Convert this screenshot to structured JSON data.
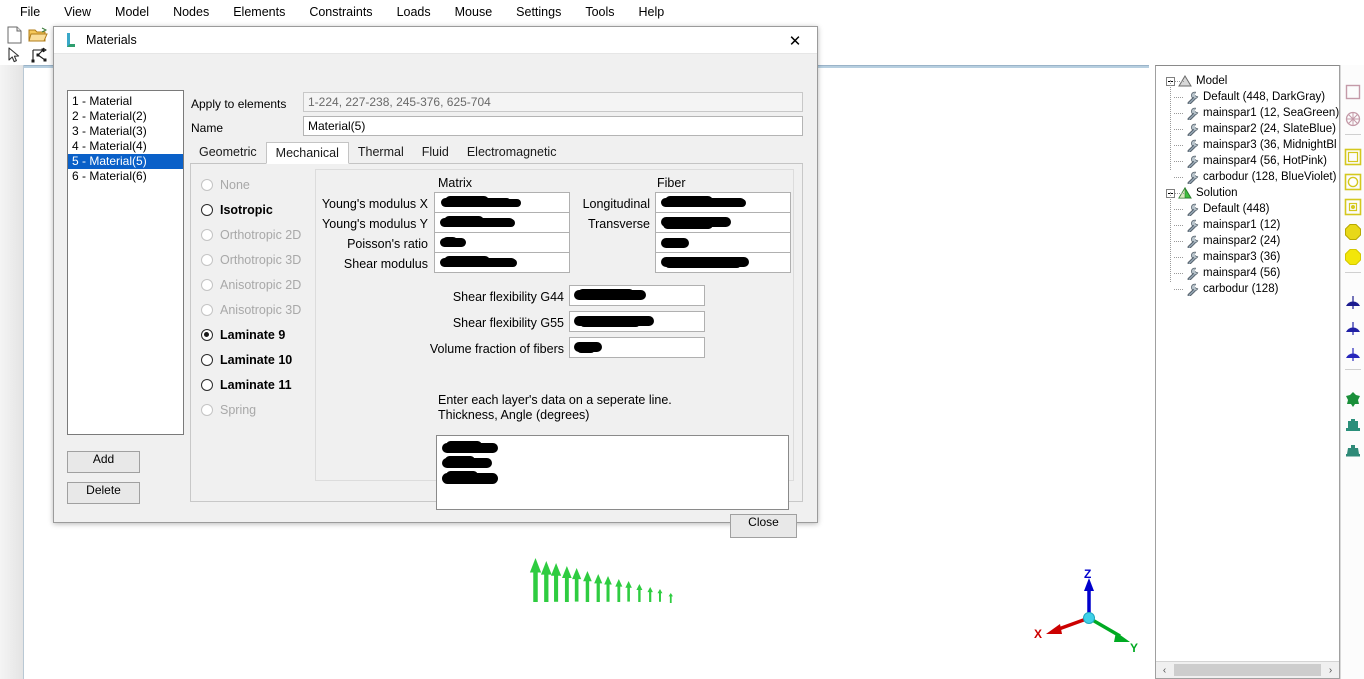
{
  "menubar": {
    "items": [
      {
        "label": "File"
      },
      {
        "label": "View"
      },
      {
        "label": "Model"
      },
      {
        "label": "Nodes"
      },
      {
        "label": "Elements"
      },
      {
        "label": "Constraints"
      },
      {
        "label": "Loads"
      },
      {
        "label": "Mouse"
      },
      {
        "label": "Settings"
      },
      {
        "label": "Tools"
      },
      {
        "label": "Help"
      }
    ]
  },
  "toolbar": {
    "icons": [
      {
        "name": "new-document-icon"
      },
      {
        "name": "open-folder-icon"
      },
      {
        "name": "select-cursor-icon"
      },
      {
        "name": "node-connect-icon"
      }
    ]
  },
  "dialog": {
    "title": "Materials",
    "logo_icon": "leonardo-l-logo-icon",
    "close_icon": "✕",
    "material_list": [
      {
        "label": "1 - Material",
        "selected": false
      },
      {
        "label": "2 - Material(2)",
        "selected": false
      },
      {
        "label": "3 - Material(3)",
        "selected": false
      },
      {
        "label": "4 - Material(4)",
        "selected": false
      },
      {
        "label": "5 - Material(5)",
        "selected": true
      },
      {
        "label": "6 - Material(6)",
        "selected": false
      }
    ],
    "add_label": "Add",
    "delete_label": "Delete",
    "close_label": "Close",
    "apply_label": "Apply to elements",
    "apply_value": "1-224, 227-238, 245-376, 625-704",
    "name_label": "Name",
    "name_value": "Material(5)",
    "tabs": [
      {
        "label": "Geometric",
        "active": false
      },
      {
        "label": "Mechanical",
        "active": true
      },
      {
        "label": "Thermal",
        "active": false
      },
      {
        "label": "Fluid",
        "active": false
      },
      {
        "label": "Electromagnetic",
        "active": false
      }
    ],
    "material_types": [
      {
        "label": "None",
        "checked": false,
        "disabled": true
      },
      {
        "label": "Isotropic",
        "checked": false,
        "disabled": false
      },
      {
        "label": "Orthotropic 2D",
        "checked": false,
        "disabled": true
      },
      {
        "label": "Orthotropic 3D",
        "checked": false,
        "disabled": true
      },
      {
        "label": "Anisotropic 2D",
        "checked": false,
        "disabled": true
      },
      {
        "label": "Anisotropic 3D",
        "checked": false,
        "disabled": true
      },
      {
        "label": "Laminate 9",
        "checked": true,
        "disabled": false
      },
      {
        "label": "Laminate 10",
        "checked": false,
        "disabled": false
      },
      {
        "label": "Laminate 11",
        "checked": false,
        "disabled": false
      },
      {
        "label": "Spring",
        "checked": false,
        "disabled": true
      }
    ],
    "matrix_header": "Matrix",
    "fiber_header": "Fiber",
    "matrix_props": [
      {
        "label": "Young's modulus X",
        "value": ""
      },
      {
        "label": "Young's modulus Y",
        "value": ""
      },
      {
        "label": "Poisson's ratio",
        "value": ""
      },
      {
        "label": "Shear modulus",
        "value": ""
      }
    ],
    "fiber_props": [
      {
        "label": "Longitudinal",
        "value": ""
      },
      {
        "label": "Transverse",
        "value": ""
      },
      {
        "label": "",
        "value": ""
      },
      {
        "label": "",
        "value": ""
      }
    ],
    "shear_props": [
      {
        "label": "Shear flexibility G44",
        "value": ""
      },
      {
        "label": "Shear flexibility G55",
        "value": ""
      },
      {
        "label": "Volume fraction of fibers",
        "value": ""
      }
    ],
    "hint_line1": "Enter each layer's data on a seperate line.",
    "hint_line2": "Thickness, Angle (degrees)",
    "layer_data_value": ""
  },
  "tree": {
    "nodes": [
      {
        "label": "Model",
        "level": 0,
        "icon": "triangle-grey-icon"
      },
      {
        "label": "Default (448, DarkGray)",
        "level": 1,
        "icon": "wrench-icon"
      },
      {
        "label": "mainspar1 (12, SeaGreen)",
        "level": 1,
        "icon": "wrench-icon"
      },
      {
        "label": "mainspar2 (24, SlateBlue)",
        "level": 1,
        "icon": "wrench-icon"
      },
      {
        "label": "mainspar3 (36, MidnightBl",
        "level": 1,
        "icon": "wrench-icon"
      },
      {
        "label": "mainspar4 (56, HotPink)",
        "level": 1,
        "icon": "wrench-icon"
      },
      {
        "label": "carbodur (128, BlueViolet)",
        "level": 1,
        "icon": "wrench-icon"
      },
      {
        "label": "Solution",
        "level": 0,
        "icon": "triangle-green-icon"
      },
      {
        "label": "Default (448)",
        "level": 1,
        "icon": "wrench-icon"
      },
      {
        "label": "mainspar1 (12)",
        "level": 1,
        "icon": "wrench-icon"
      },
      {
        "label": "mainspar2 (24)",
        "level": 1,
        "icon": "wrench-icon"
      },
      {
        "label": "mainspar3 (36)",
        "level": 1,
        "icon": "wrench-icon"
      },
      {
        "label": "mainspar4 (56)",
        "level": 1,
        "icon": "wrench-icon"
      },
      {
        "label": "carbodur (128)",
        "level": 1,
        "icon": "wrench-icon"
      }
    ],
    "scroll_left_icon": "‹",
    "scroll_right_icon": "›"
  },
  "icon_column": {
    "icons": [
      {
        "name": "wireframe-square-icon",
        "color": "#c49aa8"
      },
      {
        "name": "mesh-circle-icon",
        "color": "#c49aa8"
      },
      {
        "name": "surface-outline-icon",
        "color": "#d4c81e"
      },
      {
        "name": "surface-circle-icon",
        "color": "#d4c81e"
      },
      {
        "name": "surface-dot-icon",
        "color": "#d4c81e"
      },
      {
        "name": "shaded-octagon-icon",
        "color": "#e8d818"
      },
      {
        "name": "filled-octagon-icon",
        "color": "#f2e60a"
      },
      {
        "name": "load-dome-dark-icon",
        "color": "#1b1b8f"
      },
      {
        "name": "load-dome-mid-icon",
        "color": "#2020a5"
      },
      {
        "name": "load-dome-light-icon",
        "color": "#2626bb"
      },
      {
        "name": "constraint-green-icon",
        "color": "#1a8f3a"
      },
      {
        "name": "support-teal-icon",
        "color": "#2a8f7a"
      },
      {
        "name": "fixity-teal-icon",
        "color": "#2f8a78"
      }
    ]
  },
  "viewport": {
    "axis": {
      "z_label": "Z",
      "x_label": "X",
      "y_label": "Y",
      "z_color": "#0000cc",
      "x_color": "#cc0000",
      "y_color": "#00aa22"
    },
    "load_arrow_color": "#2ecc40",
    "load_arrow_count": 14
  }
}
